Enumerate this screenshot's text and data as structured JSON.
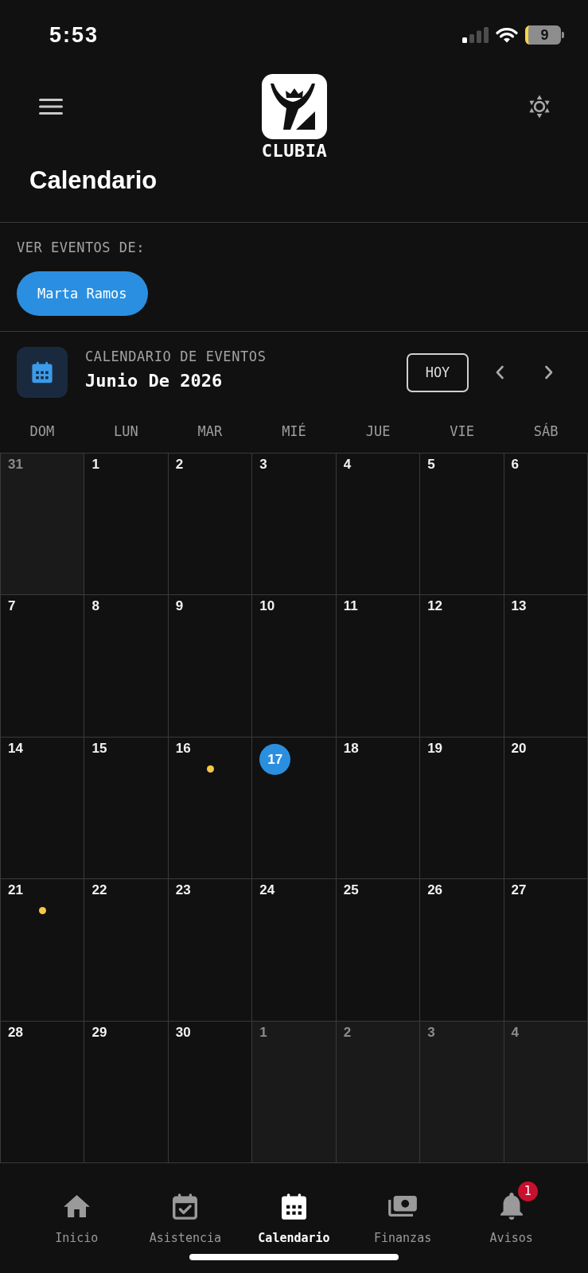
{
  "status_bar": {
    "time": "5:53",
    "battery": "9"
  },
  "header": {
    "logo_text": "CLUBIA",
    "title": "Calendario"
  },
  "filter": {
    "label": "VER EVENTOS DE:",
    "chips": [
      {
        "label": "Marta Ramos",
        "selected": true
      }
    ]
  },
  "calendar": {
    "caption": "CALENDARIO DE EVENTOS",
    "month": "Junio De 2026",
    "today_button": "HOY",
    "weekdays": [
      "DOM",
      "LUN",
      "MAR",
      "MIÉ",
      "JUE",
      "VIE",
      "SÁB"
    ],
    "weeks": [
      [
        {
          "day": "31",
          "in_month": false,
          "today": false,
          "event": false
        },
        {
          "day": "1",
          "in_month": true,
          "today": false,
          "event": false
        },
        {
          "day": "2",
          "in_month": true,
          "today": false,
          "event": false
        },
        {
          "day": "3",
          "in_month": true,
          "today": false,
          "event": false
        },
        {
          "day": "4",
          "in_month": true,
          "today": false,
          "event": false
        },
        {
          "day": "5",
          "in_month": true,
          "today": false,
          "event": false
        },
        {
          "day": "6",
          "in_month": true,
          "today": false,
          "event": false
        }
      ],
      [
        {
          "day": "7",
          "in_month": true,
          "today": false,
          "event": false
        },
        {
          "day": "8",
          "in_month": true,
          "today": false,
          "event": false
        },
        {
          "day": "9",
          "in_month": true,
          "today": false,
          "event": false
        },
        {
          "day": "10",
          "in_month": true,
          "today": false,
          "event": false
        },
        {
          "day": "11",
          "in_month": true,
          "today": false,
          "event": false
        },
        {
          "day": "12",
          "in_month": true,
          "today": false,
          "event": false
        },
        {
          "day": "13",
          "in_month": true,
          "today": false,
          "event": false
        }
      ],
      [
        {
          "day": "14",
          "in_month": true,
          "today": false,
          "event": false
        },
        {
          "day": "15",
          "in_month": true,
          "today": false,
          "event": false
        },
        {
          "day": "16",
          "in_month": true,
          "today": false,
          "event": true
        },
        {
          "day": "17",
          "in_month": true,
          "today": true,
          "event": false
        },
        {
          "day": "18",
          "in_month": true,
          "today": false,
          "event": false
        },
        {
          "day": "19",
          "in_month": true,
          "today": false,
          "event": false
        },
        {
          "day": "20",
          "in_month": true,
          "today": false,
          "event": false
        }
      ],
      [
        {
          "day": "21",
          "in_month": true,
          "today": false,
          "event": true
        },
        {
          "day": "22",
          "in_month": true,
          "today": false,
          "event": false
        },
        {
          "day": "23",
          "in_month": true,
          "today": false,
          "event": false
        },
        {
          "day": "24",
          "in_month": true,
          "today": false,
          "event": false
        },
        {
          "day": "25",
          "in_month": true,
          "today": false,
          "event": false
        },
        {
          "day": "26",
          "in_month": true,
          "today": false,
          "event": false
        },
        {
          "day": "27",
          "in_month": true,
          "today": false,
          "event": false
        }
      ],
      [
        {
          "day": "28",
          "in_month": true,
          "today": false,
          "event": false
        },
        {
          "day": "29",
          "in_month": true,
          "today": false,
          "event": false
        },
        {
          "day": "30",
          "in_month": true,
          "today": false,
          "event": false
        },
        {
          "day": "1",
          "in_month": false,
          "today": false,
          "event": false
        },
        {
          "day": "2",
          "in_month": false,
          "today": false,
          "event": false
        },
        {
          "day": "3",
          "in_month": false,
          "today": false,
          "event": false
        },
        {
          "day": "4",
          "in_month": false,
          "today": false,
          "event": false
        }
      ]
    ]
  },
  "bottom_nav": [
    {
      "kind": "home",
      "label": "Inicio",
      "selected": false
    },
    {
      "kind": "attendance",
      "label": "Asistencia",
      "selected": false
    },
    {
      "kind": "calendar",
      "label": "Calendario",
      "selected": true
    },
    {
      "kind": "payments",
      "label": "Finanzas",
      "selected": false
    },
    {
      "kind": "bell",
      "label": "Avisos",
      "selected": false,
      "badge": "1"
    }
  ]
}
